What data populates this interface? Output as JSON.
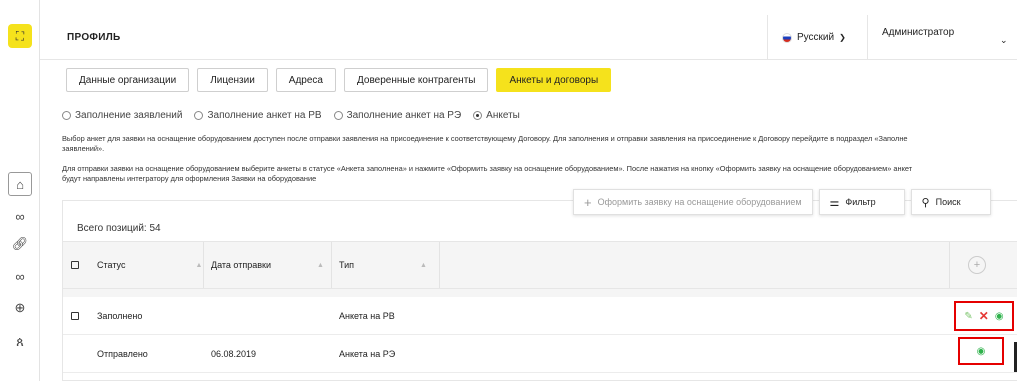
{
  "header": {
    "title": "ПРОФИЛЬ",
    "language": "Русский",
    "user": "Администратор"
  },
  "tabs": [
    {
      "label": "Данные организации",
      "active": false
    },
    {
      "label": "Лицензии",
      "active": false
    },
    {
      "label": "Адреса",
      "active": false
    },
    {
      "label": "Доверенные контрагенты",
      "active": false
    },
    {
      "label": "Анкеты и договоры",
      "active": true
    }
  ],
  "radios": [
    {
      "label": "Заполнение заявлений",
      "selected": false
    },
    {
      "label": "Заполнение анкет на РВ",
      "selected": false
    },
    {
      "label": "Заполнение анкет на РЭ",
      "selected": false
    },
    {
      "label": "Анкеты",
      "selected": true
    }
  ],
  "info": {
    "p1_line1": "Выбор анкет для заявки на оснащение оборудованием доступен после отправки заявления на присоединение к соответствующему Договору. Для заполнения и отправки заявления на присоединение к Договору перейдите в подраздел «Заполне",
    "p1_line2": "заявлений».",
    "p2_line1": "Для отправки заявки на оснащение оборудованием выберите анкеты в статусе «Анкета заполнена» и нажмите «Оформить заявку на оснащение оборудованием». После нажатия на кнопку «Оформить заявку на оснащение оборудованием» анкет",
    "p2_line2": "будут направлены интегратору для оформления Заявки на оборудование"
  },
  "toolbar": {
    "submit_label": "Оформить заявку на оснащение оборудованием",
    "filter_label": "Фильтр",
    "search_label": "Поиск"
  },
  "table": {
    "total_label": "Всего позиций: 54",
    "columns": [
      "Статус",
      "Дата отправки",
      "Тип"
    ],
    "rows": [
      {
        "status": "Заполнено",
        "date": "",
        "type": "Анкета на РВ",
        "has_checkbox": true
      },
      {
        "status": "Отправлено",
        "date": "06.08.2019",
        "type": "Анкета на РЭ",
        "has_checkbox": false
      }
    ]
  },
  "icons": {
    "logo": "logo-icon",
    "side": [
      "home-icon",
      "handshake-icon",
      "link-icon",
      "handshake-icon",
      "globe-icon",
      "user-icon"
    ]
  },
  "colors": {
    "accent": "#f5e21c",
    "highlight": "#e50000",
    "edit": "#7bc46b",
    "delete": "#e53935",
    "view": "#2fb24c"
  }
}
